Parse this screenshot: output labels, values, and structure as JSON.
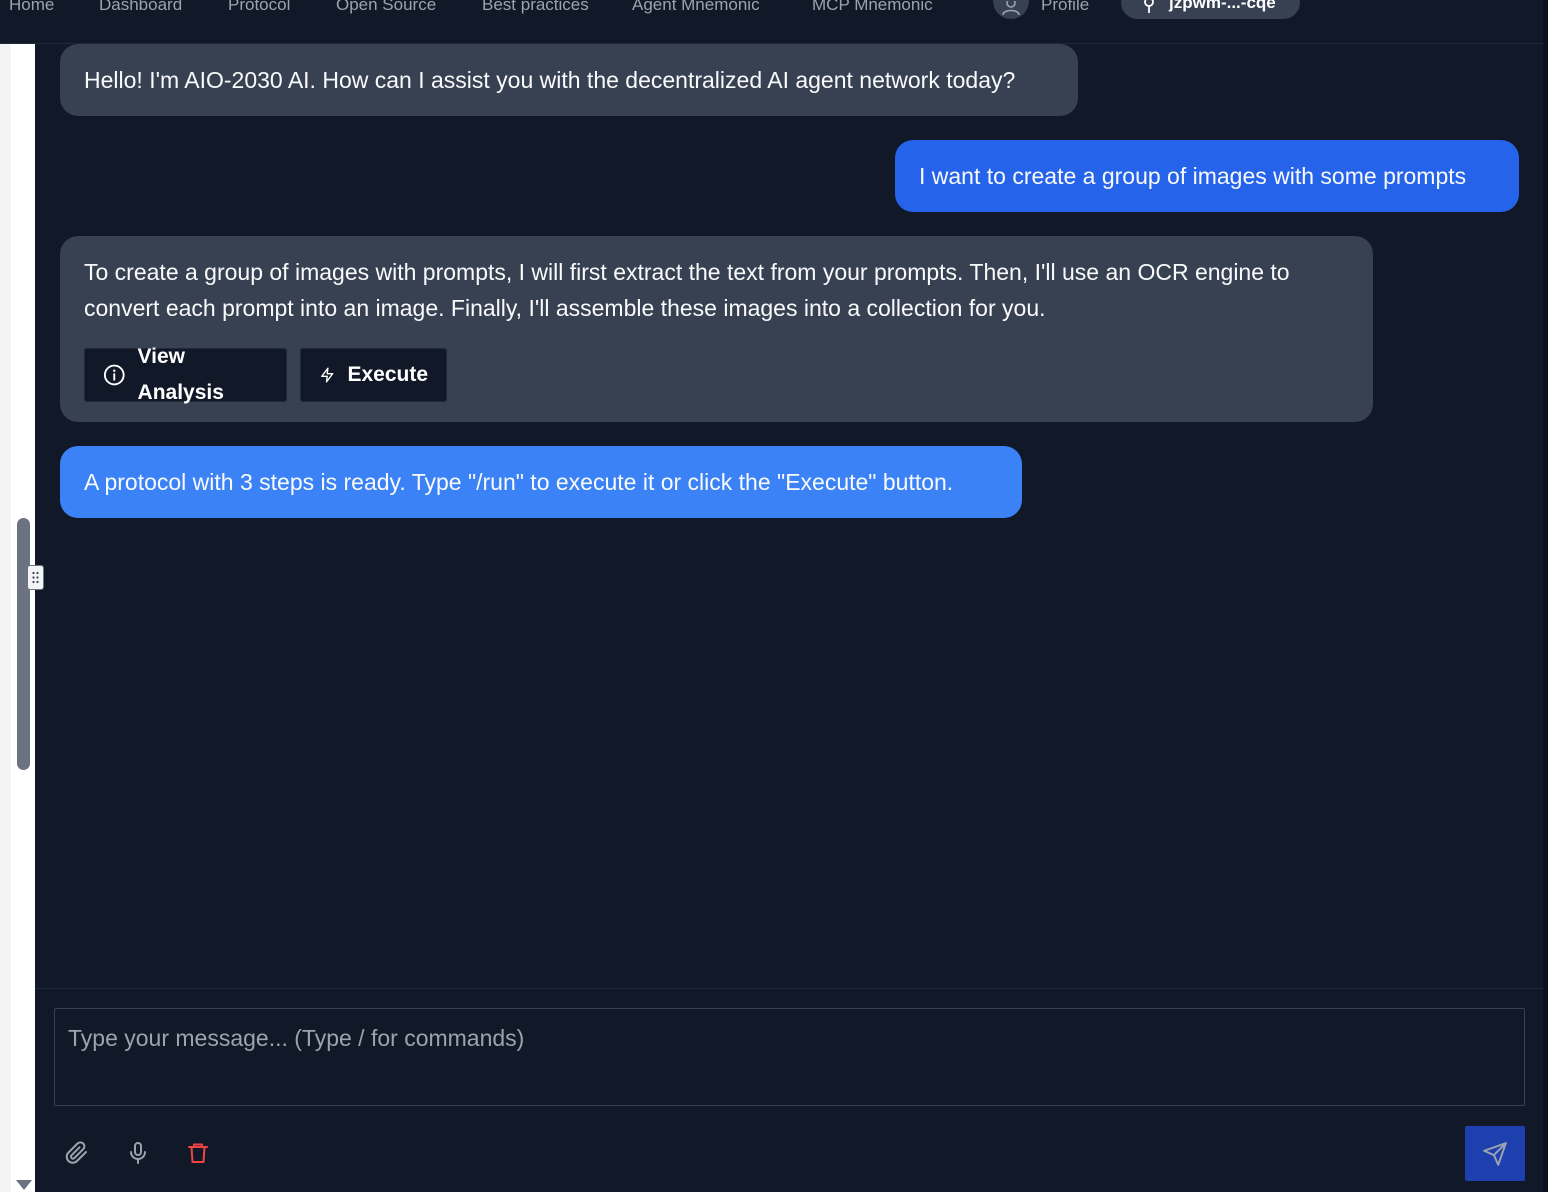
{
  "nav": {
    "items": [
      "Home",
      "Dashboard",
      "Protocol",
      "Open Source",
      "Best practices",
      "Agent Mnemonic",
      "MCP Mnemonic"
    ],
    "profile_label": "Profile",
    "wallet_label": "jzpwm-...-cqe"
  },
  "messages": {
    "ai_greeting": "Hello! I'm AIO-2030 AI. How can I assist you with the decentralized AI agent network today?",
    "user_request": "I want to create a group of images with some prompts",
    "ai_plan": "To create a group of images with prompts, I will first extract the text from your prompts. Then, I'll use an OCR engine to convert each prompt into an image. Finally, I'll assemble these images into a collection for you.",
    "system_notice": "A protocol with 3 steps is ready. Type \"/run\" to execute it or click the \"Execute\" button."
  },
  "actions": {
    "view_analysis_label": "View Analysis",
    "execute_label": "Execute"
  },
  "composer": {
    "placeholder": "Type your message... (Type / for commands)",
    "value": ""
  },
  "icons": {
    "attach": "paperclip-icon",
    "voice": "microphone-icon",
    "clear": "trash-icon",
    "send": "send-icon",
    "profile": "user-icon",
    "wallet": "key-icon"
  },
  "colors": {
    "background": "#111827",
    "ai_bubble": "#374151",
    "user_bubble": "#2563eb",
    "system_bubble": "#3b82f6",
    "danger": "#ef4444",
    "send_button": "#1e40af"
  }
}
